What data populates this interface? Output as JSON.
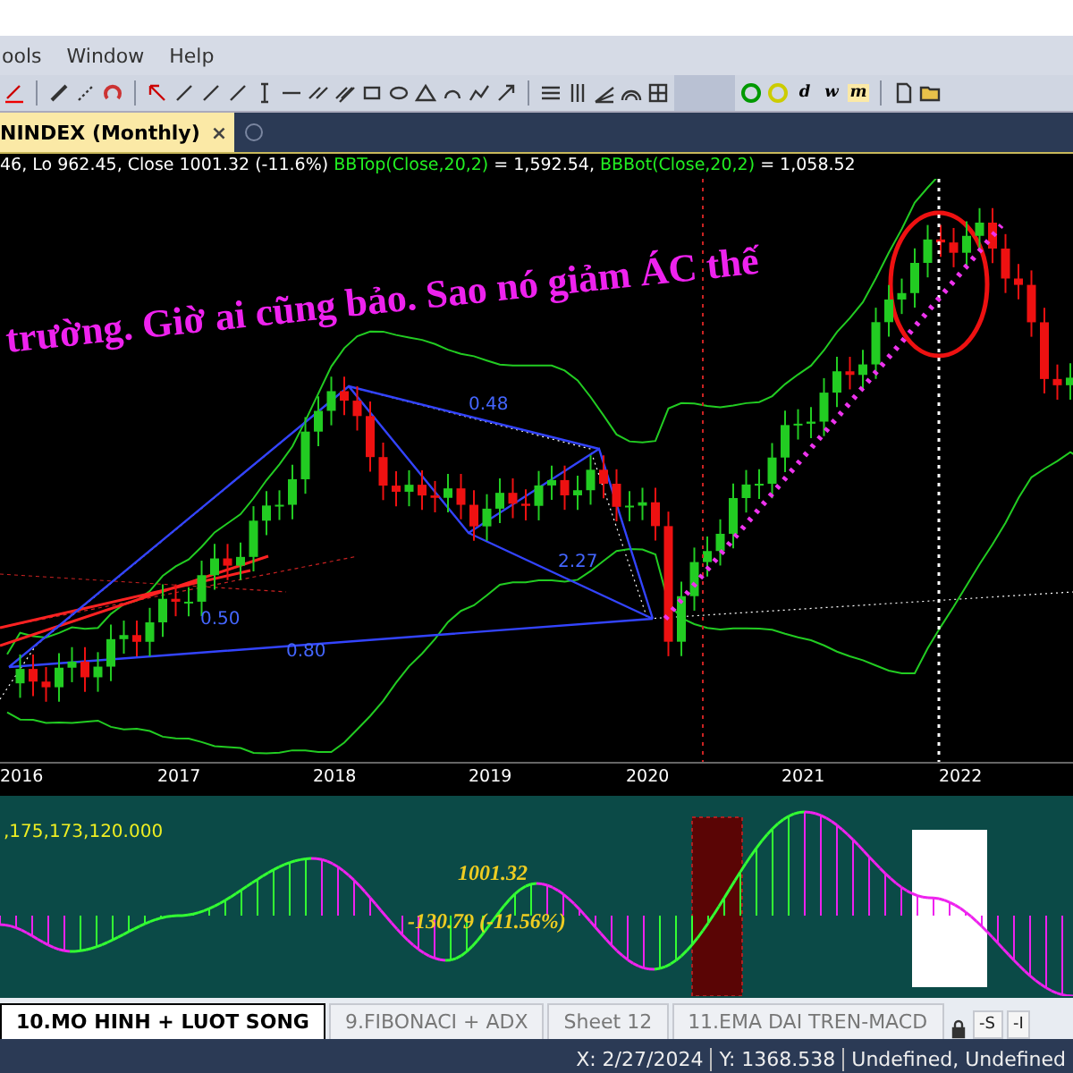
{
  "menu": [
    "ools",
    "Window",
    "Help"
  ],
  "toolbar_letters": [
    "d",
    "w",
    "m"
  ],
  "chart_tab": {
    "label": "NINDEX (Monthly)",
    "close": "×"
  },
  "info_line": [
    {
      "kind": "plain",
      "text": "46, Lo 962.45, Close 1001.32 (-11.6%) "
    },
    {
      "kind": "indicator",
      "text": "BBTop(Close,20,2)"
    },
    {
      "kind": "plain",
      "text": " = 1,592.54, "
    },
    {
      "kind": "indicator",
      "text": "BBBot(Close,20,2)"
    },
    {
      "kind": "plain",
      "text": " = 1,058.52"
    }
  ],
  "annotation": "trường. Giờ ai cũng bảo. Sao nó giảm ÁC thế",
  "fib_labels": [
    "0.48",
    "2.27",
    "0.50",
    "0.80"
  ],
  "x_axis": [
    "2016",
    "2017",
    "2018",
    "2019",
    "2020",
    "2021",
    "2022"
  ],
  "indicator": {
    "value_label": ",175,173,120.000",
    "price_label": "1001.32",
    "change_label": "-130.79 (-11.56%)"
  },
  "sheet_tabs": [
    {
      "label": "10.MO HINH + LUOT SONG",
      "selected": true
    },
    {
      "label": "9.FIBONACI + ADX",
      "selected": false
    },
    {
      "label": "Sheet 12",
      "selected": false
    },
    {
      "label": "11.EMA DAI TREN-MACD",
      "selected": false
    }
  ],
  "sheet_buttons": [
    "-S",
    "-I"
  ],
  "status_bar": [
    "X: 2/27/2024",
    "Y: 1368.538",
    "Undefined, Undefined"
  ]
}
